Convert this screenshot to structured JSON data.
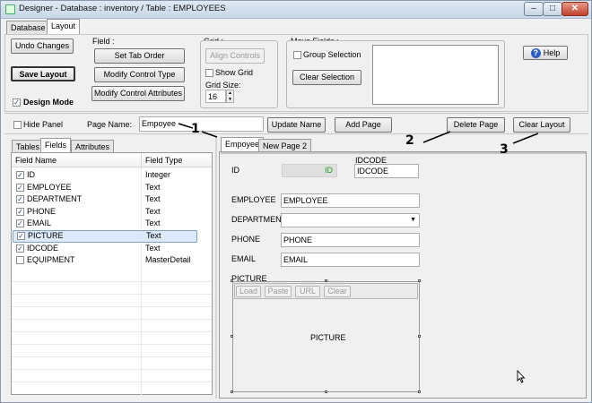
{
  "window": {
    "title": "Designer - Database : inventory / Table : EMPLOYEES",
    "controls": {
      "minimize": "–",
      "maximize": "□",
      "close": "✕"
    }
  },
  "main_tabs": [
    {
      "label": "Database",
      "selected": false
    },
    {
      "label": "Layout",
      "selected": true
    }
  ],
  "toolbar": {
    "undo_label": "Undo Changes",
    "save_label": "Save Layout",
    "design_mode_label": "Design Mode",
    "design_mode_checked": true,
    "field_group": {
      "caption": "Field :",
      "set_tab_order": "Set Tab Order",
      "modify_type": "Modify Control Type",
      "modify_attrs": "Modify Control Attributes"
    },
    "grid_group": {
      "caption": "Grid :",
      "align_controls": "Align Controls",
      "show_grid_label": "Show Grid",
      "show_grid_checked": false,
      "grid_size_label": "Grid Size:",
      "grid_size_value": "16"
    },
    "move_group": {
      "caption": "Move Fields :",
      "group_selection_label": "Group Selection",
      "group_selection_checked": false,
      "clear_selection": "Clear Selection"
    },
    "help_label": "Help",
    "help_icon": "?"
  },
  "page_bar": {
    "hide_panel_label": "Hide Panel",
    "hide_panel_checked": false,
    "page_name_label": "Page Name:",
    "page_name_value": "Empoyee",
    "update_name": "Update Name",
    "add_page": "Add Page",
    "delete_page": "Delete Page",
    "clear_layout": "Clear Layout"
  },
  "left_tabs": [
    {
      "label": "Tables",
      "selected": false
    },
    {
      "label": "Fields",
      "selected": true
    },
    {
      "label": "Attributes",
      "selected": false
    }
  ],
  "fields_table": {
    "headers": [
      "Field Name",
      "Field Type"
    ],
    "rows": [
      {
        "name": "ID",
        "type": "Integer",
        "checked": true
      },
      {
        "name": "EMPLOYEE",
        "type": "Text",
        "checked": true
      },
      {
        "name": "DEPARTMENT",
        "type": "Text",
        "checked": true
      },
      {
        "name": "PHONE",
        "type": "Text",
        "checked": true
      },
      {
        "name": "EMAIL",
        "type": "Text",
        "checked": true
      },
      {
        "name": "PICTURE",
        "type": "Text",
        "checked": true,
        "selected": true
      },
      {
        "name": "IDCODE",
        "type": "Text",
        "checked": true
      },
      {
        "name": "EQUIPMENT",
        "type": "MasterDetail",
        "checked": false
      }
    ]
  },
  "page_tabs": [
    {
      "label": "Empoyee",
      "selected": true
    },
    {
      "label": "New Page 2",
      "selected": false
    }
  ],
  "form": {
    "id_label": "ID",
    "id_value": "ID",
    "idcode_label": "IDCODE",
    "idcode_value": "IDCODE",
    "employee_label": "EMPLOYEE",
    "employee_value": "EMPLOYEE",
    "department_label": "DEPARTMENT",
    "department_value": "",
    "phone_label": "PHONE",
    "phone_value": "PHONE",
    "email_label": "EMAIL",
    "email_value": "EMAIL",
    "picture_label": "PICTURE",
    "picture_value": "PICTURE",
    "picture_buttons": [
      "Load",
      "Paste",
      "URL",
      "Clear"
    ]
  },
  "annotations": [
    "1",
    "2",
    "3"
  ],
  "colors": {
    "id_text": "#1a9a1a",
    "selected_row": "#dce9f9"
  }
}
